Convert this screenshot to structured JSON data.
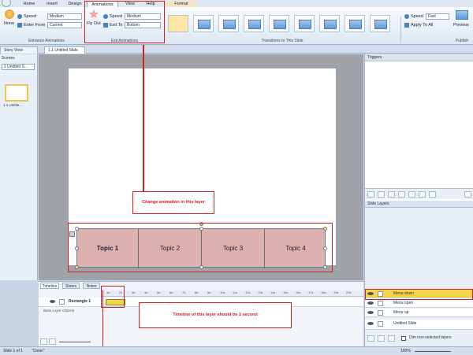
{
  "tabs": [
    "Home",
    "Insert",
    "Design",
    "Animations",
    "View",
    "Help",
    "Format"
  ],
  "ribbon": {
    "entrance": {
      "speed_label": "Speed",
      "speed_value": "Medium",
      "enter_from_label": "Enter From",
      "enter_from_value": "Current",
      "none_label": "None",
      "group_label": "Entrance Animations"
    },
    "exit": {
      "fly_out_label": "Fly Out",
      "speed_label": "Speed",
      "speed_value": "Medium",
      "exit_to_label": "Exit To",
      "exit_to_value": "Bottom",
      "group_label": "Exit Animations"
    },
    "transitions": {
      "group_label": "Transitions to This Slide"
    },
    "publish": {
      "speed_label": "Speed",
      "speed_value": "Fast",
      "apply_all_label": "Apply To All",
      "preview_label": "Preview",
      "group_label": "Publish"
    }
  },
  "doc_tabs": {
    "story_view": "Story View",
    "slide": "1.1 Untitled Slide"
  },
  "scenes": {
    "title": "Scenes",
    "selector": "1 Untitled S...",
    "thumb_label": "1.1 Untitle..."
  },
  "slide": {
    "topics": [
      "Topic 1",
      "Topic 2",
      "Topic 3",
      "Topic 4"
    ]
  },
  "triggers": {
    "title": "Triggers"
  },
  "slide_layers": {
    "title": "Slide Layers",
    "rows": [
      "Menu down",
      "Menu open",
      "Menu up",
      "Untitled Slide"
    ],
    "dim_label": "Dim non-selected layers"
  },
  "timeline": {
    "tabs": [
      "Timeline",
      "States",
      "Notes"
    ],
    "row_label": "Rectangle 1",
    "base_label": "Base Layer Objects",
    "ticks": [
      "1s",
      "2s",
      "3s",
      "4s",
      "5s",
      "6s",
      "7s",
      "8s",
      "9s",
      "10s",
      "11s",
      "12s",
      "13s",
      "14s",
      "15s",
      "16s",
      "17s",
      "18s",
      "19s",
      "20s"
    ]
  },
  "annotations": {
    "change_anim": "Change animation in this layer",
    "timeline_note": "Timeline of this layer should be 1 second"
  },
  "status": {
    "slide": "Slide 1 of 1",
    "theme": "\"Clean\"",
    "zoom": "100%"
  },
  "colors": {
    "accent": "#d42020",
    "shape_fill": "#deb1b1",
    "selected_layer": "#f5d34a"
  }
}
